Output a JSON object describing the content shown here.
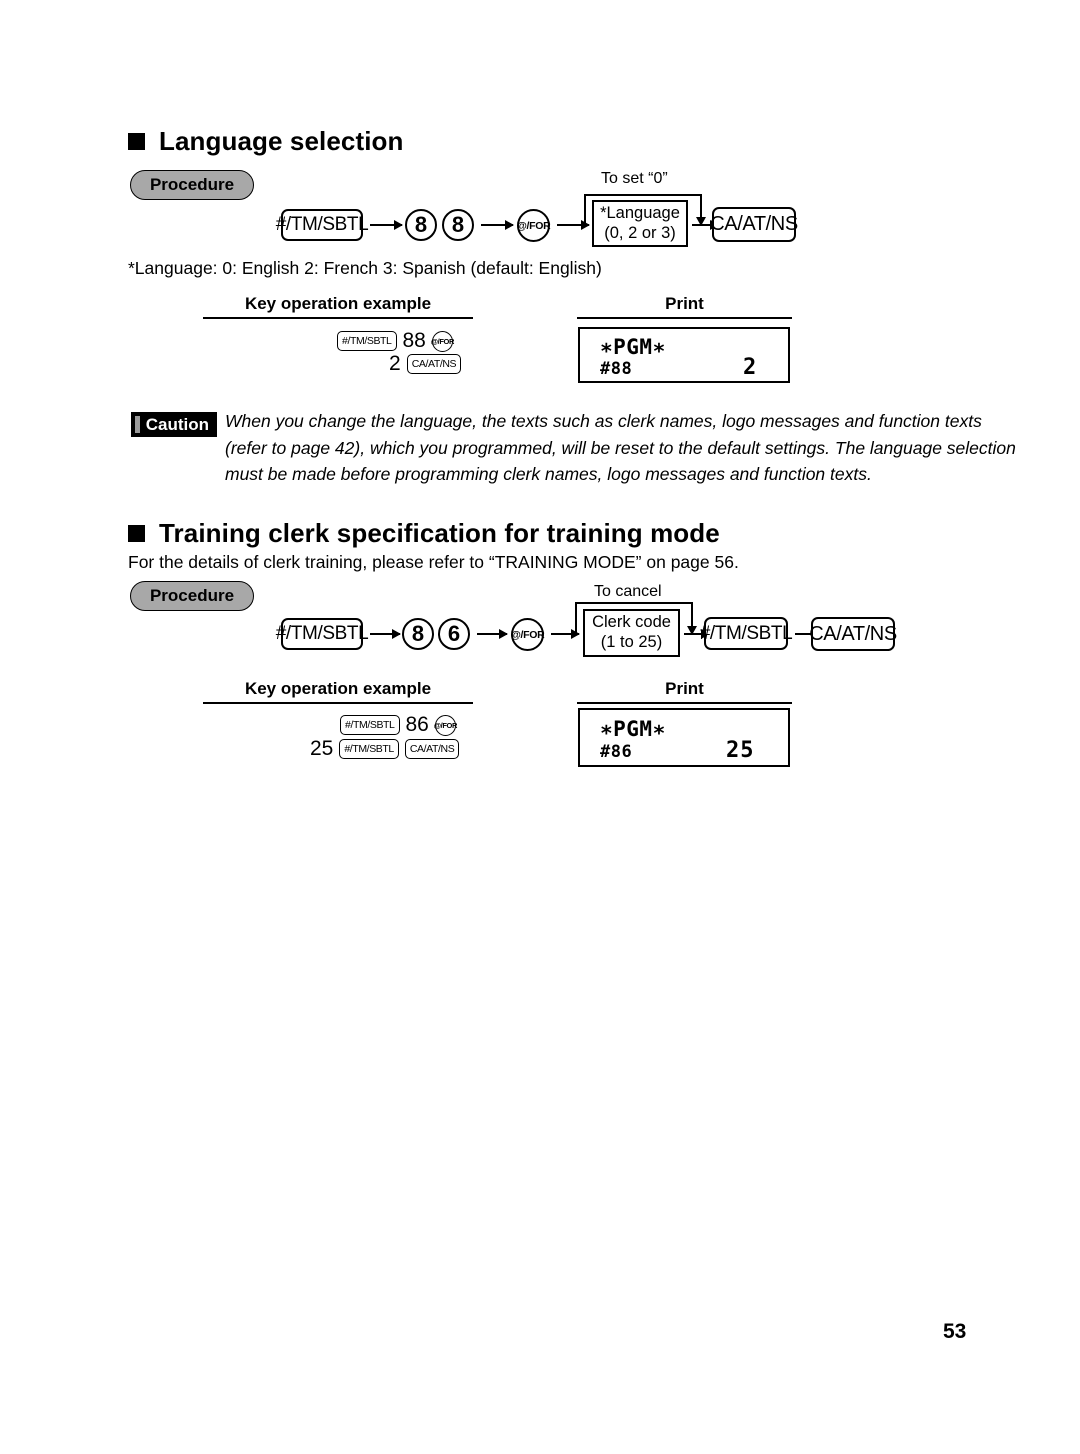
{
  "page": {
    "number": "53"
  },
  "sections": [
    {
      "heading": "Language selection",
      "procedure_label": "Procedure",
      "flow": {
        "branch_label": "To set “0”",
        "keys": {
          "subtotal": "#/TM/SBTL",
          "digit1": "8",
          "digit2": "8",
          "for": "@/FOR",
          "cash": "CA/AT/NS"
        },
        "entry_box": {
          "line1": "*Language",
          "line2": "(0, 2 or 3)"
        }
      },
      "footnote": "*Language: 0: English      2: French      3: Spanish  (default: English)",
      "example_header": "Key operation example",
      "print_header": "Print",
      "example": {
        "row1": {
          "key1": "#/TM/SBTL",
          "value": "88",
          "key2": "@/FOR"
        },
        "row2": {
          "value": "2",
          "key1": "CA/AT/NS"
        }
      },
      "print": {
        "title": "∗PGM∗",
        "code": "#88",
        "value": "2"
      }
    },
    {
      "heading": "Training clerk specification for training mode",
      "intro": "For the details of clerk training, please refer to “TRAINING MODE” on page 56.",
      "procedure_label": "Procedure",
      "flow": {
        "branch_label": "To cancel",
        "keys": {
          "subtotal": "#/TM/SBTL",
          "digit1": "8",
          "digit2": "6",
          "for": "@/FOR",
          "subtotal2": "#/TM/SBTL",
          "cash": "CA/AT/NS"
        },
        "entry_box": {
          "line1": "Clerk code",
          "line2": "(1 to 25)"
        }
      },
      "example_header": "Key operation example",
      "print_header": "Print",
      "example": {
        "row1": {
          "key1": "#/TM/SBTL",
          "value": "86",
          "key2": "@/FOR"
        },
        "row2": {
          "value": "25",
          "key1": "#/TM/SBTL",
          "key2": "CA/AT/NS"
        }
      },
      "print": {
        "title": "∗PGM∗",
        "code": "#86",
        "value": "25"
      }
    }
  ],
  "caution": {
    "label": "Caution",
    "text": "When you change the language, the texts such as clerk names, logo messages and function texts (refer to page 42), which you programmed, will be reset to the default settings.  The language selection must be made before programming clerk names, logo messages and function texts."
  }
}
